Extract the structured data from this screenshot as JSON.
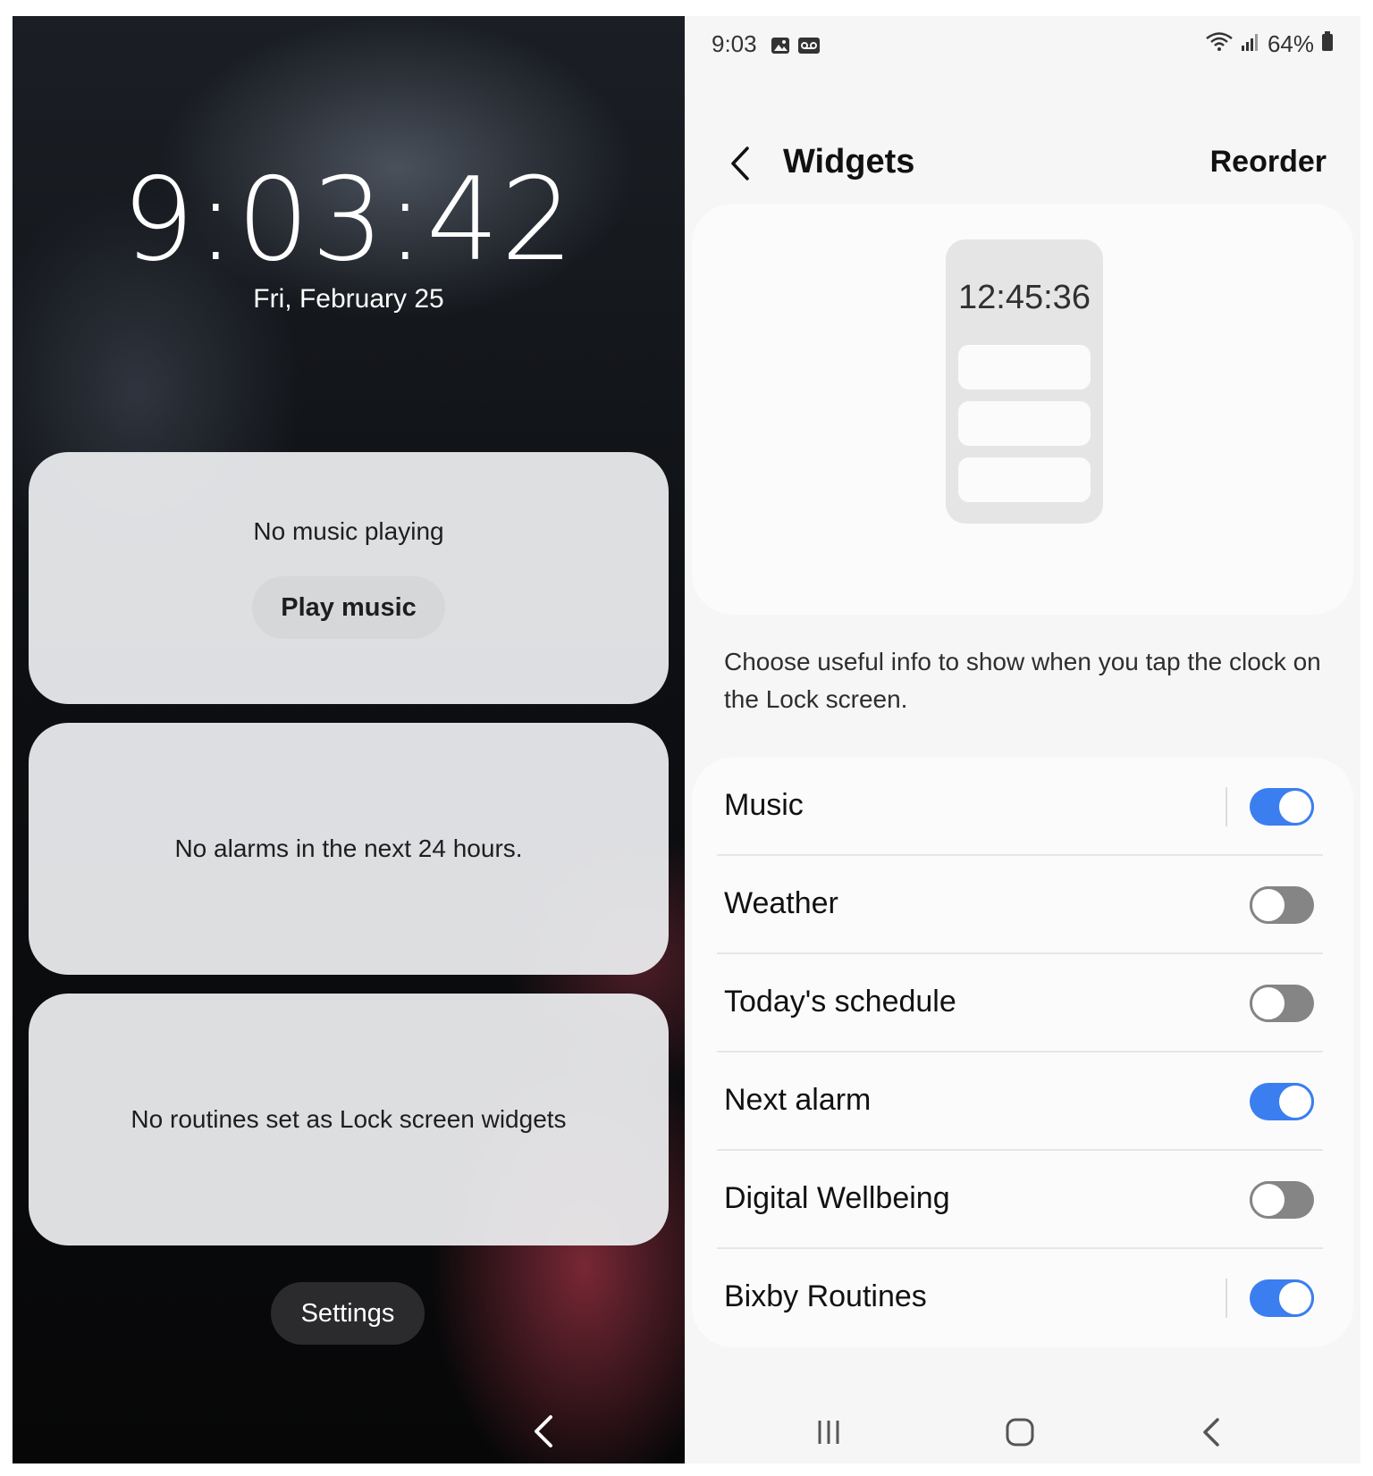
{
  "lock_screen": {
    "time": "9:03:42",
    "date": "Fri, February 25",
    "music_widget": {
      "status": "No music playing",
      "button": "Play music"
    },
    "alarm_widget": {
      "status": "No alarms in the next 24 hours."
    },
    "routines_widget": {
      "status": "No routines set as Lock screen widgets"
    },
    "settings_button": "Settings",
    "nav_icon": "back-icon"
  },
  "settings_screen": {
    "status_bar": {
      "time": "9:03",
      "left_icons": [
        "gallery-icon",
        "voicemail-icon"
      ],
      "battery": "64%",
      "right_icons": [
        "wifi-icon",
        "signal-icon",
        "battery-icon"
      ]
    },
    "header": {
      "title": "Widgets",
      "reorder_label": "Reorder"
    },
    "preview": {
      "clock": "12:45:36"
    },
    "description": "Choose useful info to show when you tap the clock on the Lock screen.",
    "toggles": [
      {
        "label": "Music",
        "on": true
      },
      {
        "label": "Weather",
        "on": false
      },
      {
        "label": "Today's schedule",
        "on": false
      },
      {
        "label": "Next alarm",
        "on": true
      },
      {
        "label": "Digital Wellbeing",
        "on": false
      },
      {
        "label": "Bixby Routines",
        "on": true
      }
    ],
    "nav_icons": [
      "recents-icon",
      "home-icon",
      "back-icon"
    ]
  },
  "colors": {
    "toggle_on": "#3b7ef0",
    "toggle_off": "#858585"
  }
}
